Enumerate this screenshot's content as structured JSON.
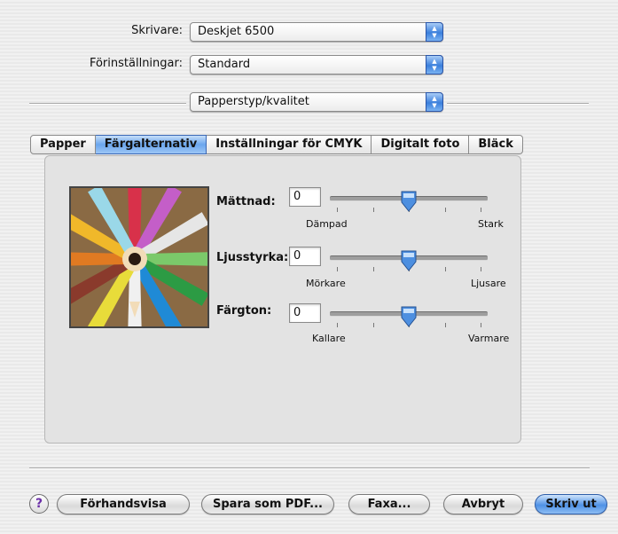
{
  "printer": {
    "label": "Skrivare:",
    "value": "Deskjet 6500"
  },
  "presets": {
    "label": "Förinställningar:",
    "value": "Standard"
  },
  "panel_select": {
    "value": "Papperstyp/kvalitet"
  },
  "tabs": [
    "Papper",
    "Färgalternativ",
    "Inställningar för CMYK",
    "Digitalt foto",
    "Bläck"
  ],
  "active_tab": "Färgalternativ",
  "sliders": [
    {
      "label": "Mättnad:",
      "value": "0",
      "min_label": "Dämpad",
      "max_label": "Stark",
      "level": 0.5
    },
    {
      "label": "Ljusstyrka:",
      "value": "0",
      "min_label": "Mörkare",
      "max_label": "Ljusare",
      "level": 0.5
    },
    {
      "label": "Färgton:",
      "value": "0",
      "min_label": "Kallare",
      "max_label": "Varmare",
      "level": 0.5
    }
  ],
  "buttons": {
    "help": "?",
    "preview": "Förhandsvisa",
    "save_pdf": "Spara som PDF...",
    "fax": "Faxa...",
    "cancel": "Avbryt",
    "print": "Skriv ut"
  },
  "icons": {
    "popup_arrows": "up-down-arrows-icon",
    "help": "help-icon",
    "slider_knob": "slider-thumb-icon"
  },
  "colors": {
    "accent": "#3b7fdc"
  }
}
